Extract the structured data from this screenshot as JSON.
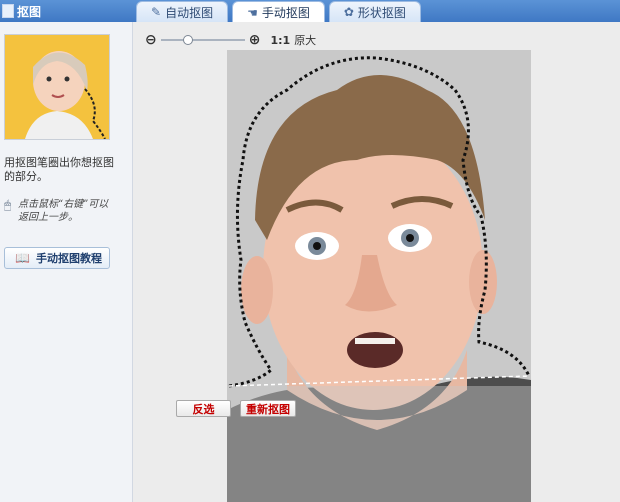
{
  "app": {
    "title": "抠图"
  },
  "tabs": [
    {
      "label": "自动抠图",
      "icon": "brush-icon",
      "active": false
    },
    {
      "label": "手动抠图",
      "icon": "hand-icon",
      "active": true
    },
    {
      "label": "形状抠图",
      "icon": "shape-icon",
      "active": false
    }
  ],
  "sidebar": {
    "help_text": "用抠图笔圈出你想抠图的部分。",
    "tip_text": "点击鼠标“右键”可以返回上一步。",
    "tutorial_label": "手动抠图教程"
  },
  "zoom": {
    "ratio": "1:1",
    "ratio_label": "原大",
    "slider_value": 0.3
  },
  "actions": {
    "invert_label": "反选",
    "reset_label": "重新抠图"
  },
  "colors": {
    "topbar": "#4a86cf",
    "button_text": "#c40000"
  }
}
